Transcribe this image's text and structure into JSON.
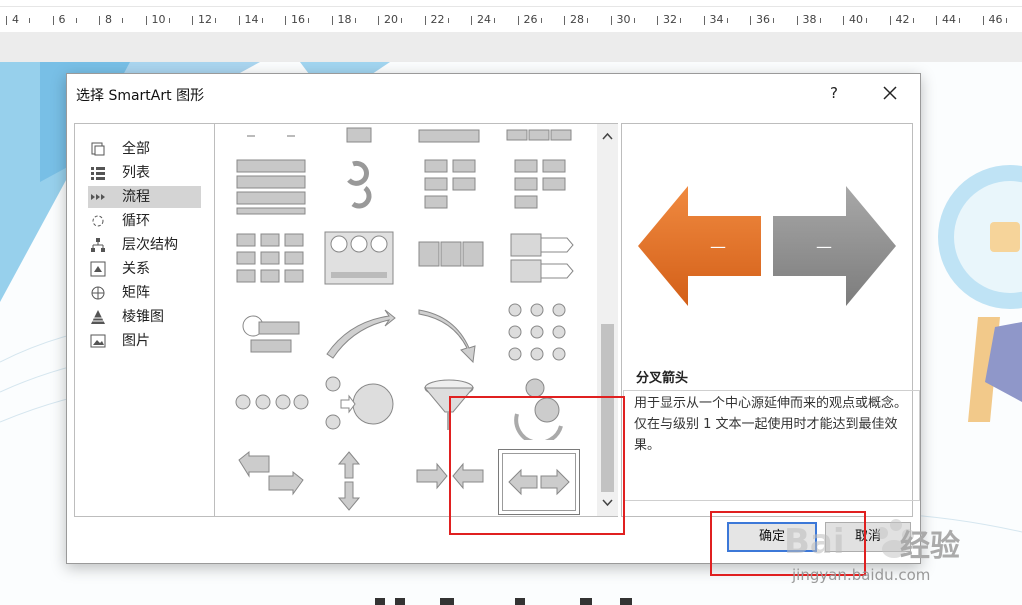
{
  "ruler": {
    "numbers": [
      "4",
      "6",
      "8",
      "10",
      "12",
      "14",
      "16",
      "18",
      "20",
      "22",
      "24",
      "26",
      "28",
      "30",
      "32",
      "34",
      "36",
      "38",
      "40",
      "42",
      "44",
      "46"
    ]
  },
  "dialog": {
    "title": "选择 SmartArt 图形",
    "help": "?",
    "categories": [
      {
        "label": "全部",
        "icon": "all-icon"
      },
      {
        "label": "列表",
        "icon": "list-icon"
      },
      {
        "label": "流程",
        "icon": "process-icon"
      },
      {
        "label": "循环",
        "icon": "cycle-icon"
      },
      {
        "label": "层次结构",
        "icon": "hierarchy-icon"
      },
      {
        "label": "关系",
        "icon": "relationship-icon"
      },
      {
        "label": "矩阵",
        "icon": "matrix-icon"
      },
      {
        "label": "棱锥图",
        "icon": "pyramid-icon"
      },
      {
        "label": "图片",
        "icon": "picture-icon"
      }
    ],
    "selected_category": "流程",
    "preview": {
      "title": "分叉箭头",
      "description": "用于显示从一个中心源延伸而来的观点或概念。仅在与级别 1 文本一起使用时才能达到最佳效果。",
      "left_arrow_color": "#e0702a",
      "right_arrow_color": "#8e8e8e",
      "arrow_text": "—"
    },
    "ok_label": "确定",
    "cancel_label": "取消"
  },
  "colors": {
    "accent": "#3c78d8",
    "annotation": "#e02020",
    "selected": "#d4d4d4"
  },
  "watermark": {
    "brand": "Bai",
    "brand2": "经验",
    "sub": "jingyan.baidu.com"
  }
}
